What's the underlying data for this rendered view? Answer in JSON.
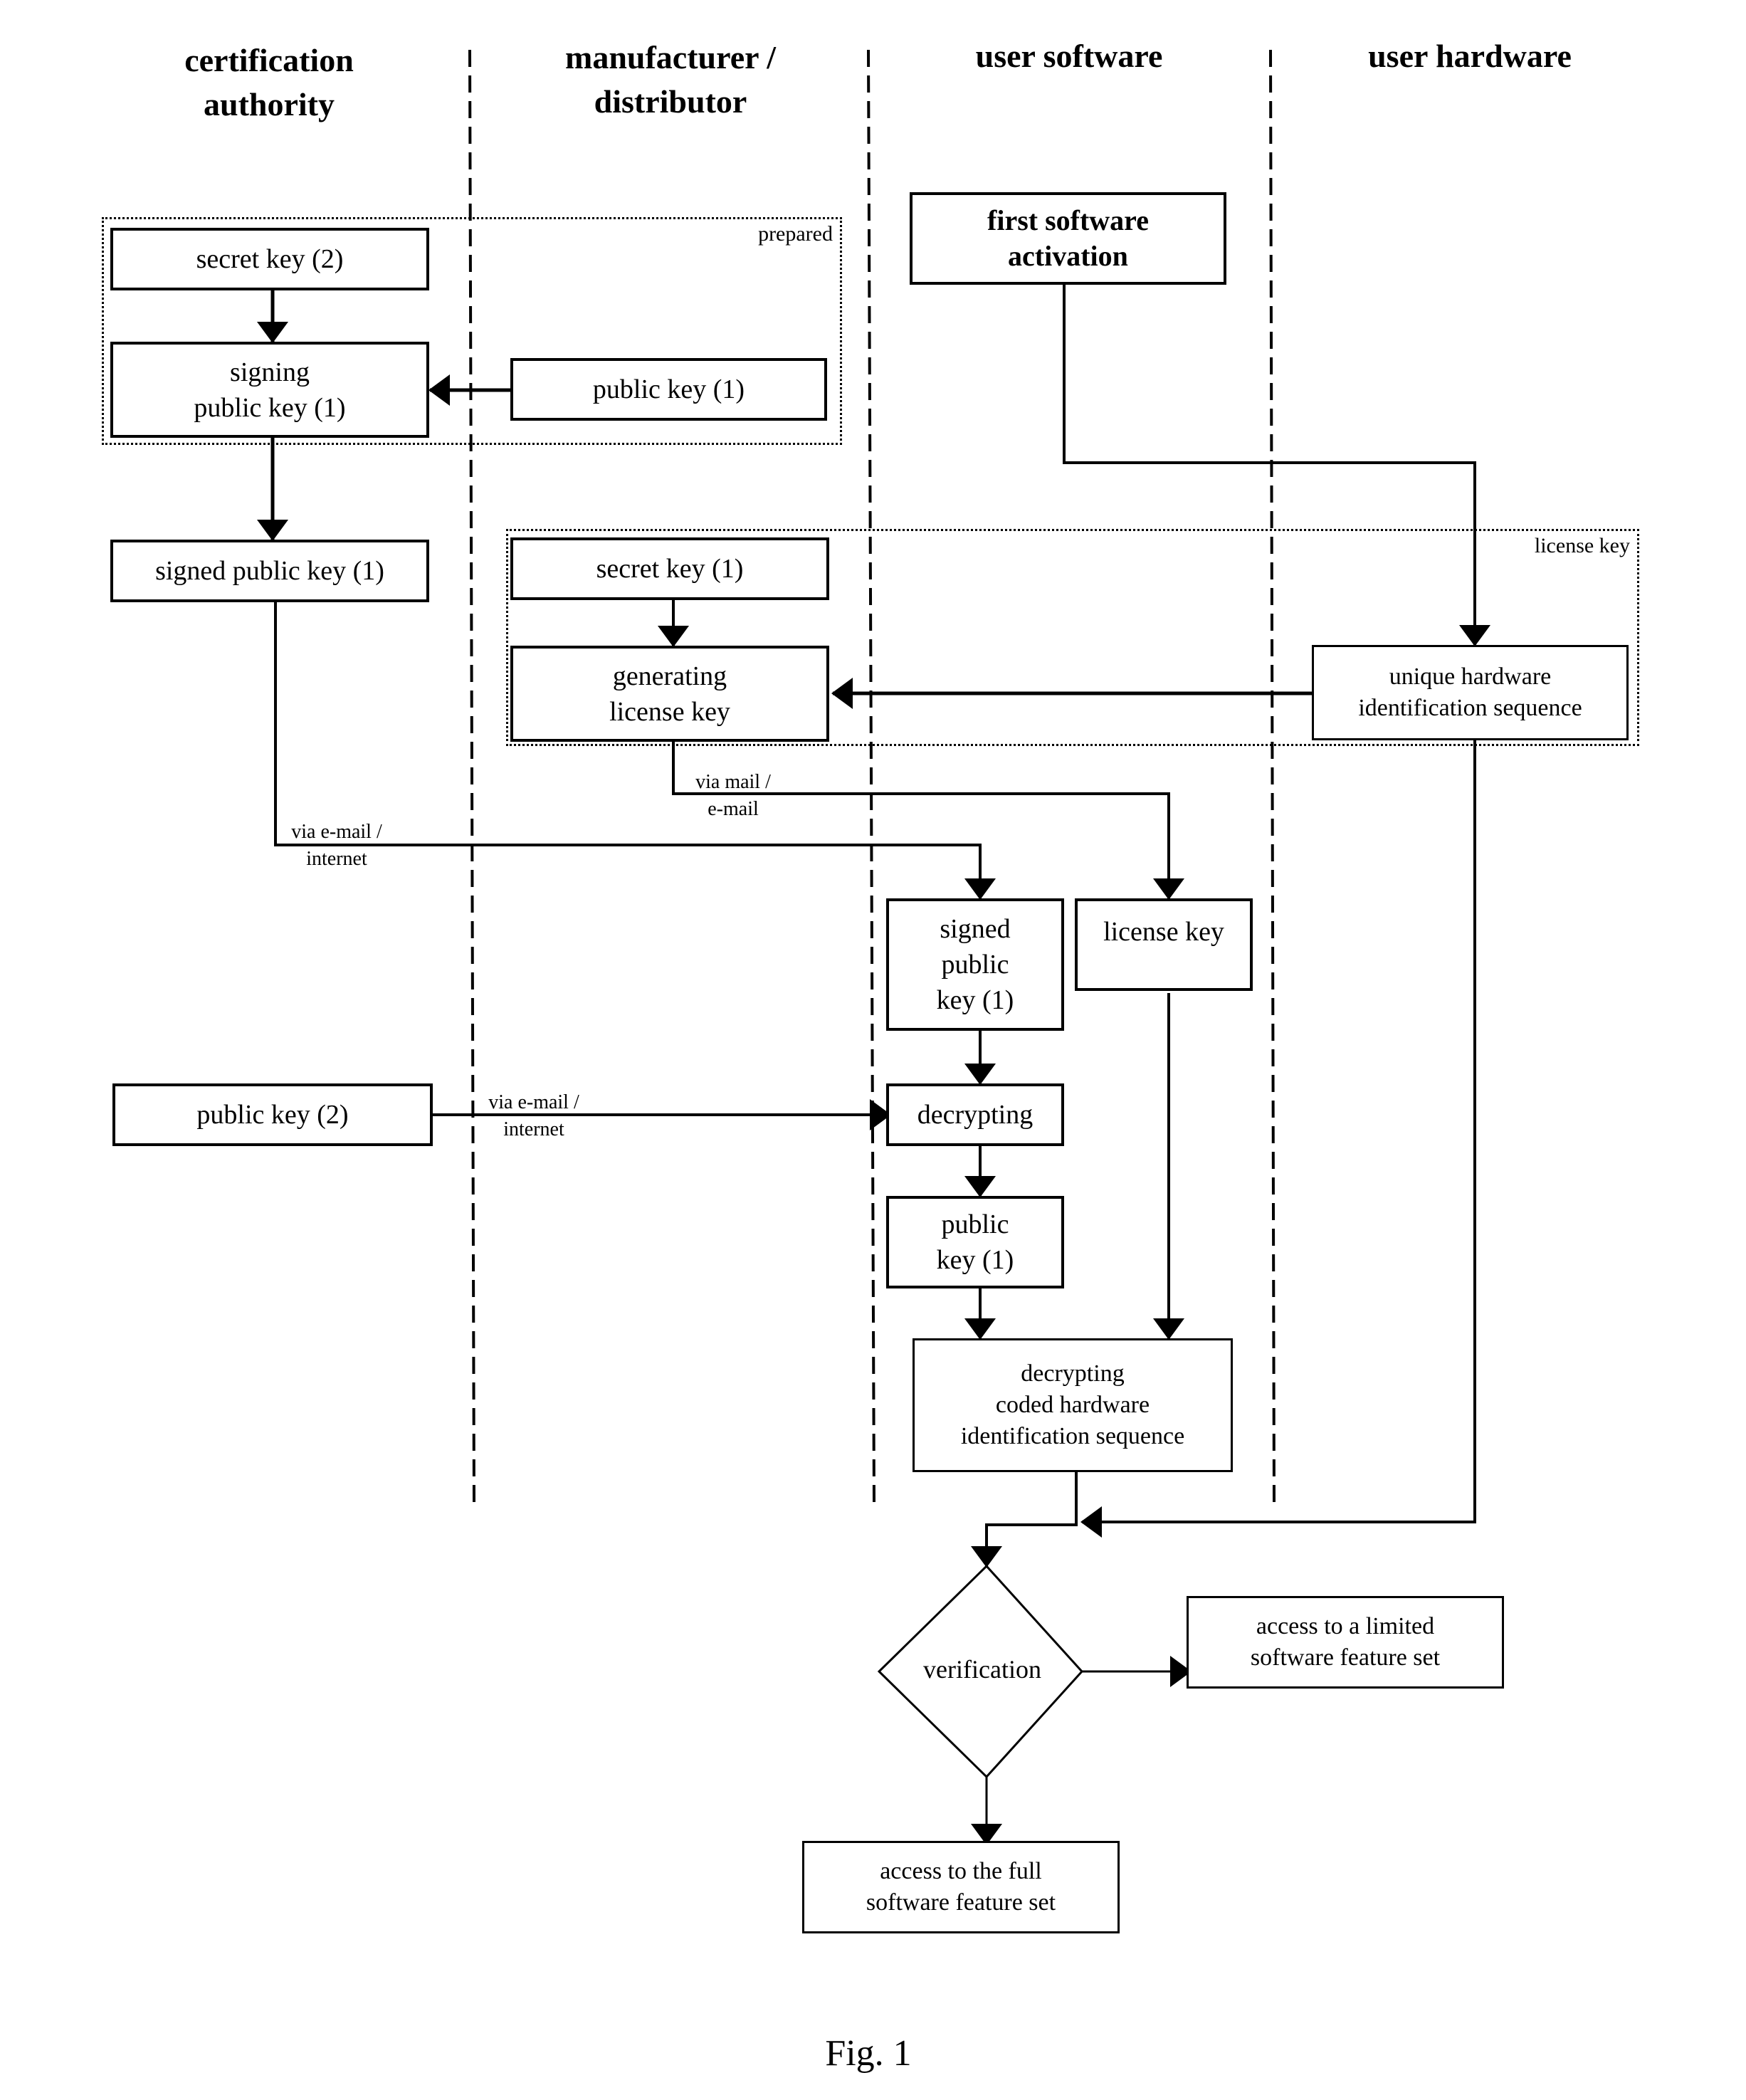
{
  "lanes": [
    {
      "id": "ca",
      "title": "certification\nauthority"
    },
    {
      "id": "md",
      "title": "manufacturer /\ndistributor"
    },
    {
      "id": "us",
      "title": "user software"
    },
    {
      "id": "uh",
      "title": "user hardware"
    }
  ],
  "groups": {
    "prepared": "prepared",
    "license_key": "license key"
  },
  "nodes": {
    "secret_key_2": "secret key (2)",
    "signing_public_key_1": "signing\npublic key (1)",
    "public_key_1_md": "public key (1)",
    "first_software_activation": "first software\nactivation",
    "signed_public_key_1_ca": "signed public key (1)",
    "secret_key_1": "secret key (1)",
    "generating_license_key": "generating\nlicense key",
    "unique_hardware_id": "unique hardware\nidentification sequence",
    "signed_public_key_1_us": "signed\npublic\nkey (1)",
    "license_key_us": "license key",
    "public_key_2": "public key (2)",
    "decrypting": "decrypting",
    "public_key_1_us": "public\nkey (1)",
    "decrypting_coded_hw": "decrypting\ncoded hardware\nidentification sequence",
    "verification": "verification",
    "access_limited": "access to a limited\nsoftware feature set",
    "access_full": "access to the full\nsoftware feature set"
  },
  "edge_labels": {
    "via_mail": "via mail /\ne-mail",
    "via_email_internet_1": "via e-mail /\ninternet",
    "via_email_internet_2": "via e-mail /\ninternet"
  },
  "caption": "Fig. 1"
}
